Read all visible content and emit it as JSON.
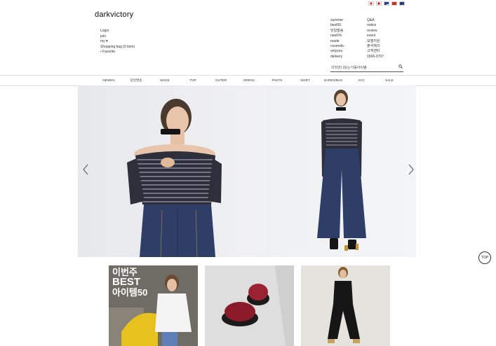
{
  "header": {
    "logo": "darkvictory"
  },
  "flags": [
    "flag-korea",
    "flag-japan",
    "flag-usa",
    "flag-china",
    "flag-taiwan"
  ],
  "account_links": [
    "Login",
    "join",
    "my ♥",
    "Shopping bag (0 item)",
    "• Favorite"
  ],
  "menu_col1": [
    "summer",
    "best50",
    "당일발송",
    "new5%",
    "made",
    "cosmetic",
    "onlyyou",
    "delivery"
  ],
  "menu_col2": [
    "Q&A",
    "notice",
    "review",
    "event",
    "모델지원",
    "출석체크",
    "고객센터",
    "1566-3707"
  ],
  "search": {
    "text": "이되안나보는가홀아이템"
  },
  "nav": [
    "NEW5%",
    "당일발송",
    "MADE",
    "TOP",
    "OUTER",
    "DRESS",
    "PANTS",
    "SKIRT",
    "SHOES/BAG",
    "ACC",
    "SALE"
  ],
  "top_button": "TOP",
  "thumbs": {
    "first_overlay": [
      "이번주",
      "BEST",
      "아이템50"
    ]
  },
  "colors": {
    "accent": "#222222",
    "denim": "#2f3e66",
    "fur": "#8b1a2b"
  }
}
